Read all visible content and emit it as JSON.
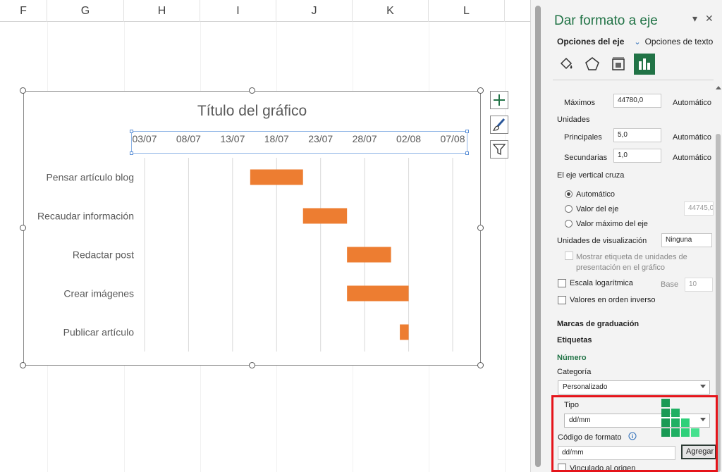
{
  "columns": [
    "F",
    "G",
    "H",
    "I",
    "J",
    "K",
    "L"
  ],
  "chart": {
    "title": "Título del gráfico",
    "date_ticks": [
      "03/07",
      "08/07",
      "13/07",
      "18/07",
      "23/07",
      "28/07",
      "02/08",
      "07/08"
    ]
  },
  "chart_data": {
    "type": "bar",
    "orientation": "horizontal",
    "title": "Título del gráfico",
    "categories": [
      "Pensar artículo blog",
      "Recaudar información",
      "Redactar post",
      "Crear imágenes",
      "Publicar artículo"
    ],
    "x_axis_position": "top",
    "xlim": [
      "2022-07-03",
      "2022-08-07"
    ],
    "series": [
      {
        "start": [
          "2022-07-15",
          "2022-07-21",
          "2022-07-26",
          "2022-07-26",
          "2022-08-01"
        ],
        "end": [
          "2022-07-21",
          "2022-07-26",
          "2022-07-31",
          "2022-08-02",
          "2022-08-02"
        ],
        "color": "#ed7d31"
      }
    ],
    "grid": true,
    "legend": "none"
  },
  "chart_tools": {
    "icons": [
      "plus-icon",
      "brush-icon",
      "filter-icon"
    ]
  },
  "pane": {
    "title": "Dar formato a eje",
    "tabs": {
      "axis": "Opciones del eje",
      "text": "Opciones de texto"
    },
    "icons": [
      "fill-bucket-icon",
      "pentagon-icon",
      "size-properties-icon",
      "bar-chart-icon"
    ],
    "max": {
      "label": "Máximos",
      "value": "44780,0",
      "auto": "Automático"
    },
    "units_heading": "Unidades",
    "principal": {
      "label": "Principales",
      "value": "5,0",
      "auto": "Automático"
    },
    "secundaria": {
      "label": "Secundarias",
      "value": "1,0",
      "auto": "Automático"
    },
    "cross_heading": "El eje vertical cruza",
    "cross_options": [
      {
        "label": "Automático",
        "selected": true
      },
      {
        "label": "Valor del eje",
        "selected": false,
        "value": "44745,0"
      },
      {
        "label": "Valor máximo del eje",
        "selected": false
      }
    ],
    "display_units": {
      "label": "Unidades de visualización",
      "value": "Ninguna"
    },
    "show_units_label": "Mostrar etiqueta de unidades de presentación en el gráfico",
    "log_scale": {
      "label": "Escala logarítmica",
      "base_label": "Base",
      "base_value": "10"
    },
    "reverse": "Valores en orden inverso",
    "ticks_heading": "Marcas de graduación",
    "labels_heading": "Etiquetas",
    "number_heading": "Número",
    "category": {
      "label": "Categoría",
      "value": "Personalizado"
    },
    "type": {
      "label": "Tipo",
      "value": "dd/mm"
    },
    "format_code": {
      "label": "Código de formato",
      "value": "dd/mm",
      "button": "Agregar"
    },
    "linked": "Vinculado al origen"
  },
  "colors": {
    "accent": "#217346",
    "bar": "#ed7d31",
    "highlight": "#e5141a"
  }
}
